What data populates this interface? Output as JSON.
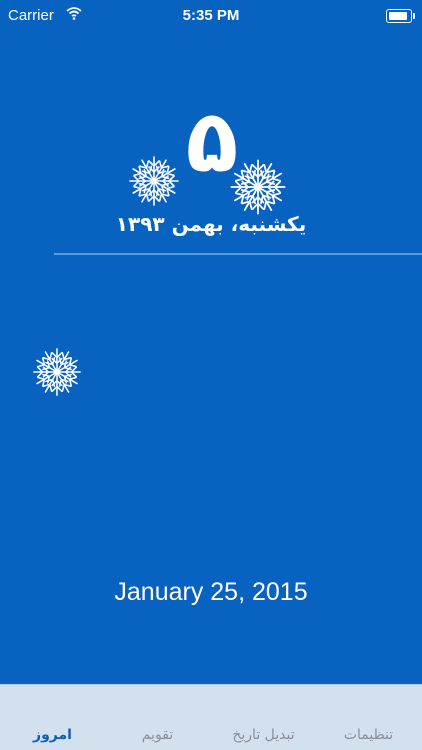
{
  "status_bar": {
    "carrier": "Carrier",
    "time": "5:35 PM",
    "battery_level": 0.9
  },
  "today": {
    "day_number": "۵",
    "persian_date": "یکشنبه، بهمن ۱۳۹۳",
    "gregorian_date": "January 25, 2015"
  },
  "tabs": {
    "today": "امروز",
    "calendar": "تقویم",
    "convert": "تبدیل تاریخ",
    "settings": "تنظیمات"
  },
  "colors": {
    "background": "#0862bf",
    "active_tab": "#0a5fb8",
    "tab_bar": "#d3e1ef"
  },
  "icons": [
    "wifi-icon",
    "battery-icon",
    "snowflake-icon"
  ]
}
